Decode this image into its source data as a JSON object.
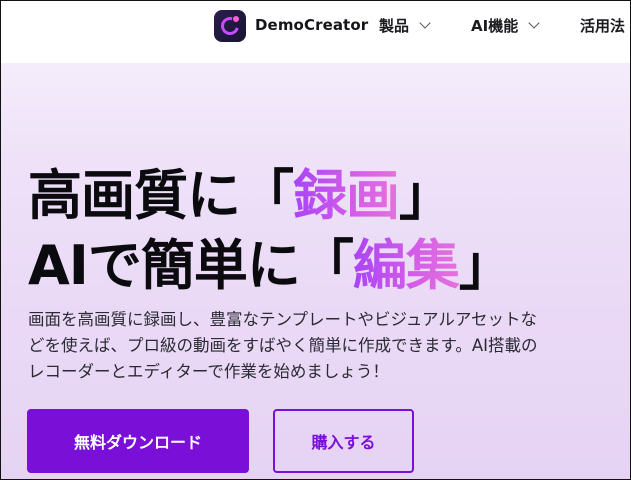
{
  "header": {
    "brand_name": "DemoCreator",
    "logo_icon": "democreator-logo-icon",
    "nav": [
      {
        "label": "製品",
        "icon": "chevron-down-icon"
      },
      {
        "label": "AI機能",
        "icon": "chevron-down-icon"
      },
      {
        "label": "活用法"
      }
    ]
  },
  "hero": {
    "title_line1": {
      "prefix": "高画質に「",
      "highlight": "録画",
      "suffix": "」"
    },
    "title_line2": {
      "prefix": "AIで簡単に「",
      "highlight": "編集",
      "suffix": "」"
    },
    "description_lines": [
      "画面を高画質に録画し、豊富なテンプレートやビジュアルアセットな",
      "どを使えば、プロ級の動画をすばやく簡単に作成できます。AI搭載の",
      "レコーダーとエディターで作業を始めましょう！"
    ],
    "primary_button": "無料ダウンロード",
    "secondary_button": "購入する"
  },
  "colors": {
    "accent": "#7a0fd8",
    "highlight_gradient_start": "#a944f5",
    "highlight_gradient_end": "#e572dc",
    "hero_background": "#eee1f8"
  }
}
